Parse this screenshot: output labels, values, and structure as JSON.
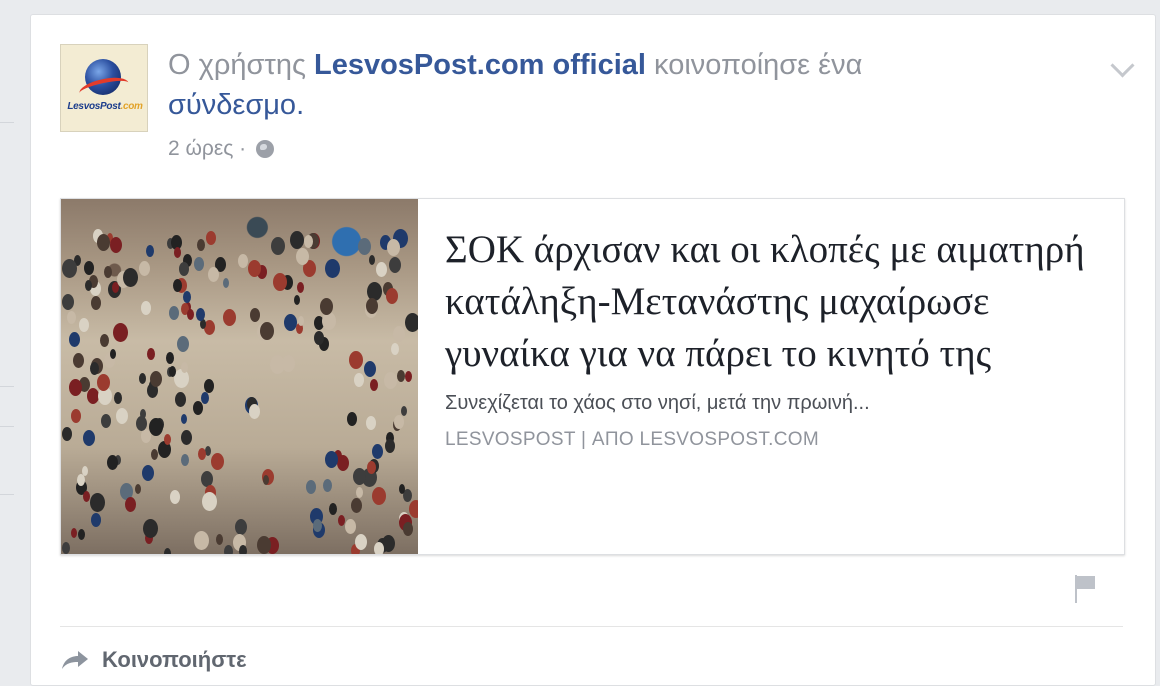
{
  "post": {
    "prefix": "Ο χρήστης ",
    "author": "LesvosPost.com official",
    "action": " κοινοποίησε ένα ",
    "object": "σύνδεσμο.",
    "time": "2 ώρες",
    "separator": " · ",
    "avatar_text_main": "LesvosPost",
    "avatar_text_tld": ".com"
  },
  "link_preview": {
    "headline": "ΣΟΚ άρχισαν και οι κλοπές με αιματηρή κατάληξη-Μετανάστης μαχαίρωσε γυναίκα για να πάρει το κινητό της",
    "description": "Συνεχίζεται το χάος στο νησί, μετά την πρωινή...",
    "source_name": "LESVOSPOST",
    "source_divider": " | ",
    "source_domain": "ΑΠΟ LESVOSPOST.COM"
  },
  "actions": {
    "share_label": "Κοινοποιήστε"
  },
  "icons": {
    "privacy": "globe-icon",
    "menu": "chevron-down-icon",
    "report": "flag-icon",
    "share": "share-arrow-icon"
  },
  "colors": {
    "link_blue": "#365899",
    "meta_gray": "#90949c",
    "headline_text": "#1d2129",
    "page_background": "#e9ebee"
  }
}
